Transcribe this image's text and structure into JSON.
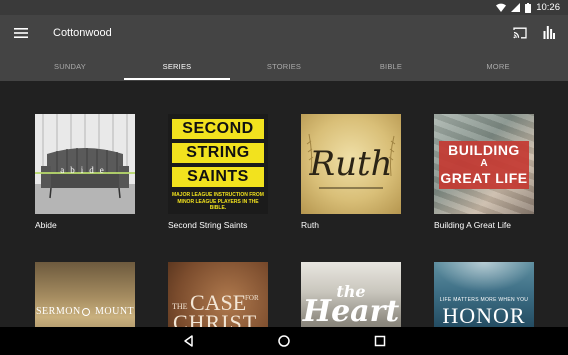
{
  "status": {
    "time": "10:26"
  },
  "appbar": {
    "title": "Cottonwood"
  },
  "tabs": [
    {
      "label": "SUNDAY"
    },
    {
      "label": "SERIES"
    },
    {
      "label": "STORIES"
    },
    {
      "label": "BIBLE"
    },
    {
      "label": "MORE"
    }
  ],
  "series": [
    {
      "title": "Abide",
      "art_text": "abide"
    },
    {
      "title": "Second String Saints",
      "art_line1": "SECOND",
      "art_line2": "STRING",
      "art_line3": "SAINTS",
      "art_sub1": "MAJOR LEAGUE INSTRUCTION FROM",
      "art_sub2": "MINOR LEAGUE PLAYERS IN THE BIBLE."
    },
    {
      "title": "Ruth",
      "art_text": "Ruth"
    },
    {
      "title": "Building A Great Life",
      "art_line1": "BUILDING",
      "art_line2": "A",
      "art_line3": "GREAT LIFE"
    }
  ],
  "series_row2": [
    {
      "art_line1": "SERMON",
      "art_line2": "MOUNT"
    },
    {
      "art_line1": "THE",
      "art_line2": "CASE",
      "art_line3": "FOR",
      "art_line4": "CHRIST"
    },
    {
      "art_line1": "the",
      "art_line2": "Heart"
    },
    {
      "art_sub": "LIFE MATTERS MORE WHEN YOU",
      "art_line1": "HONOR"
    }
  ],
  "colors": {
    "accent_yellow": "#f2e21e",
    "background": "#212121",
    "toolbar": "#444444"
  }
}
